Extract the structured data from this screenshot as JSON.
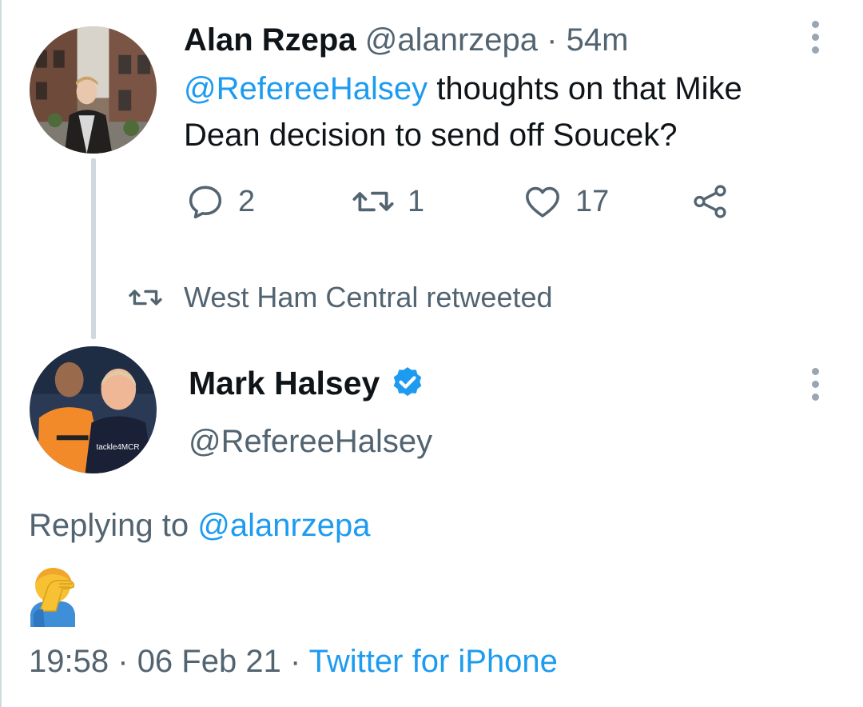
{
  "tweet": {
    "author_name": "Alan Rzepa",
    "author_handle": "@alanrzepa",
    "separator": "·",
    "time_ago": "54m",
    "mention": "@RefereeHalsey",
    "text": "thoughts on that Mike Dean decision to send off Soucek?",
    "actions": {
      "reply_count": "2",
      "retweet_count": "1",
      "like_count": "17"
    }
  },
  "retweet_notice": "West Ham Central retweeted",
  "reply": {
    "author_name": "Mark Halsey",
    "author_handle": "@RefereeHalsey",
    "verified": true,
    "replying_prefix": "Replying to",
    "replying_handle": "@alanrzepa",
    "content_emoji": "woman-facepalming",
    "time": "19:58",
    "date": "06 Feb 21",
    "separator": "·",
    "source": "Twitter for iPhone"
  },
  "colors": {
    "link": "#1d9bf0",
    "secondary_text": "#536471",
    "primary_text": "#0f1419",
    "thread_line": "#cfd9de"
  }
}
